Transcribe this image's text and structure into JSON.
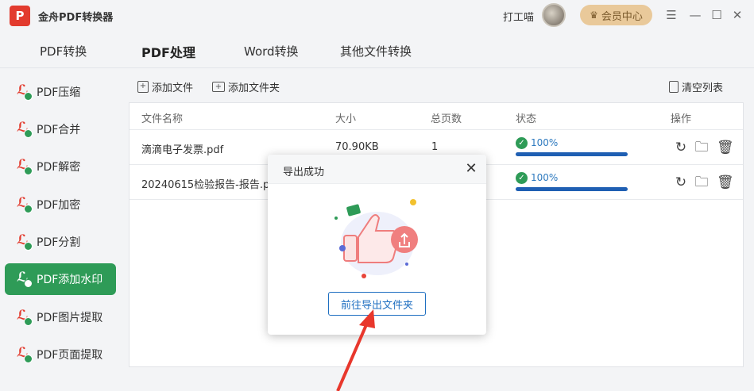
{
  "app": {
    "logo_text": "P",
    "title": "金舟PDF转换器",
    "username": "打工喵",
    "vip_label": "会员中心"
  },
  "window_controls": [
    "☰",
    "—",
    "☐",
    "✕"
  ],
  "main_tabs": [
    {
      "label": "PDF转换"
    },
    {
      "label": "PDF处理"
    },
    {
      "label": "Word转换"
    },
    {
      "label": "其他文件转换"
    }
  ],
  "sidebar": {
    "items": [
      {
        "label": "PDF压缩"
      },
      {
        "label": "PDF合并"
      },
      {
        "label": "PDF解密"
      },
      {
        "label": "PDF加密"
      },
      {
        "label": "PDF分割"
      },
      {
        "label": "PDF添加水印"
      },
      {
        "label": "PDF图片提取"
      },
      {
        "label": "PDF页面提取"
      }
    ]
  },
  "toolbar": {
    "add_file": "添加文件",
    "add_folder": "添加文件夹",
    "clear_list": "清空列表"
  },
  "table": {
    "headers": {
      "name": "文件名称",
      "size": "大小",
      "pages": "总页数",
      "status": "状态",
      "actions": "操作"
    },
    "rows": [
      {
        "name": "滴滴电子发票.pdf",
        "size": "70.90KB",
        "pages": "1",
        "status": "100%",
        "progress": 1.0
      },
      {
        "name": "20240615检验报告-报告.pdf",
        "size": "",
        "pages": "",
        "status": "100%",
        "progress": 1.0
      }
    ]
  },
  "modal": {
    "title": "导出成功",
    "button": "前往导出文件夹"
  },
  "colors": {
    "accent_green": "#2e9b57",
    "pdf_red": "#e23b2e",
    "progress_blue": "#1f5fb3",
    "arrow_red": "#e8372c"
  }
}
